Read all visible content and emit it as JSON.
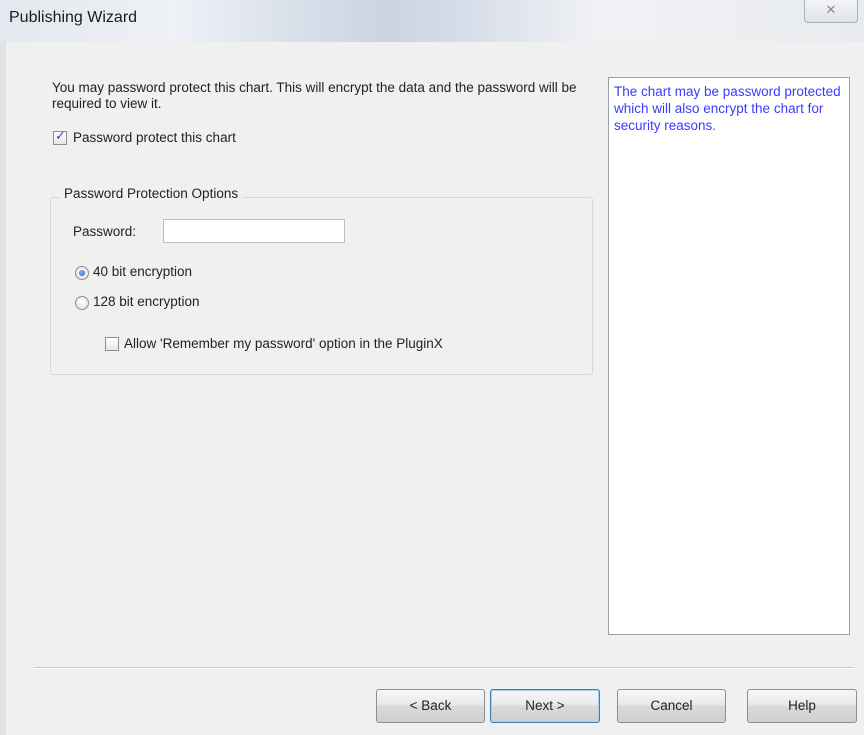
{
  "window": {
    "title": "Publishing Wizard",
    "close_glyph": "✕"
  },
  "intro": {
    "text": "You may password protect this chart. This will encrypt the data and the password will be required to view it."
  },
  "protect_checkbox": {
    "label": "Password protect this chart",
    "checked": true
  },
  "options_group": {
    "title": "Password Protection Options",
    "password_label": "Password:",
    "password_value": "",
    "radio_40": {
      "label": "40 bit encryption",
      "selected": true
    },
    "radio_128": {
      "label": "128 bit encryption",
      "selected": false
    },
    "remember_checkbox": {
      "label": "Allow 'Remember my password' option in the PluginX",
      "checked": false
    }
  },
  "help": {
    "text": "The chart may be password protected which will also encrypt the chart for security reasons."
  },
  "buttons": {
    "back": "< Back",
    "next": "Next >",
    "cancel": "Cancel",
    "help": "Help"
  },
  "colors": {
    "help_text": "#3a3aff",
    "radio_selected": "#1f5fb8"
  }
}
